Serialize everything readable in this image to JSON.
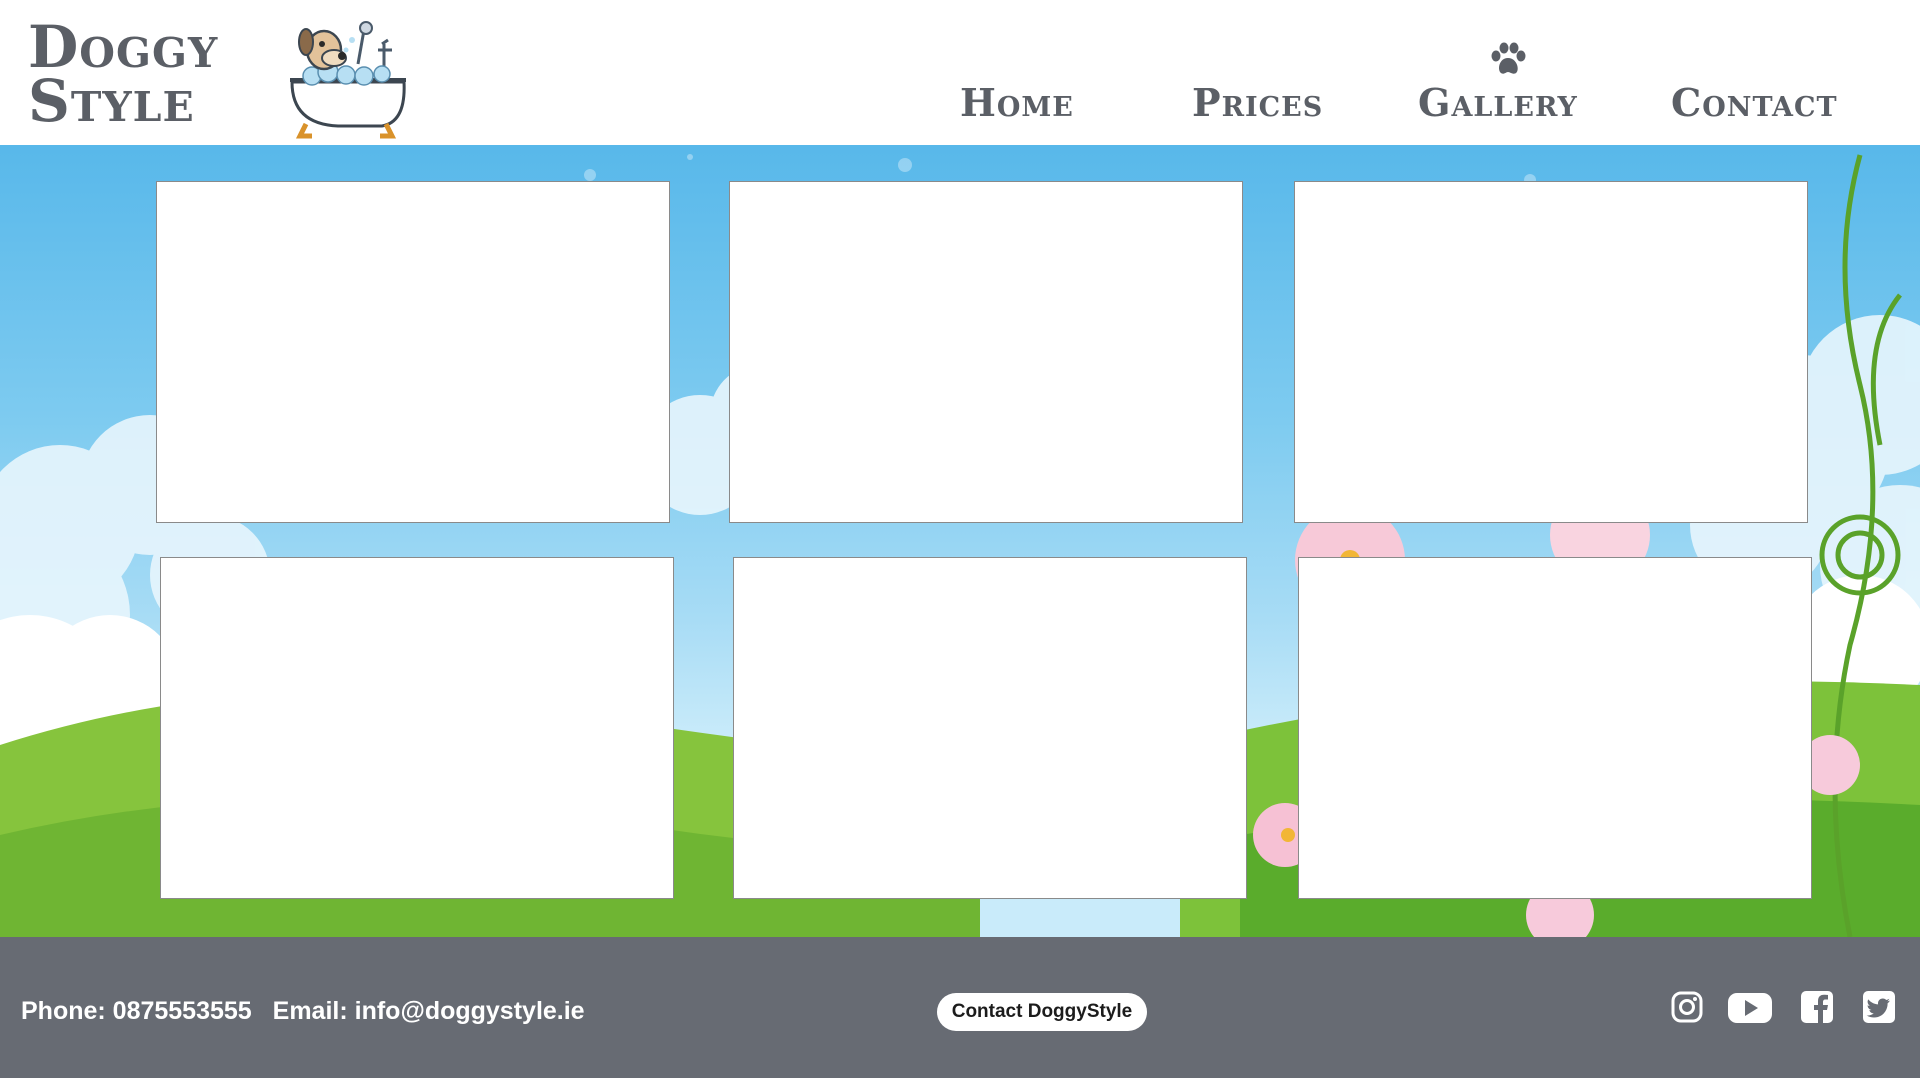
{
  "brand": {
    "line1": "Doggy",
    "line2": "Style",
    "mascot_icon": "dog-in-bathtub-icon",
    "text_color": "#5b5f66"
  },
  "nav": {
    "items": [
      {
        "label": "Home"
      },
      {
        "label": "Prices"
      },
      {
        "label": "Gallery",
        "active": true,
        "icon": "paw-icon"
      },
      {
        "label": "Contact"
      }
    ]
  },
  "gallery": {
    "tile_count": 6,
    "tiles": [
      "",
      "",
      "",
      "",
      "",
      ""
    ]
  },
  "footer": {
    "phone": "Phone: 0875553555",
    "email": "Email: info@doggystyle.ie",
    "cta_label": "Contact DoggyStyle",
    "background": "#676b73",
    "social": [
      "instagram-icon",
      "youtube-icon",
      "facebook-icon",
      "twitter-icon"
    ]
  }
}
